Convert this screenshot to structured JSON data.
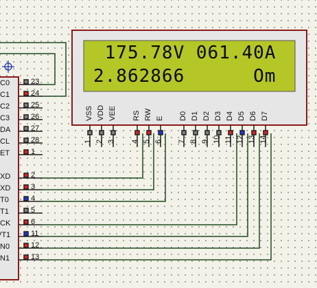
{
  "colors": {
    "wire": "#1f4a1f",
    "component_border": "#8b1a1a",
    "lcd_body": "#e8e8e8",
    "lcd_screen": "#b5c627",
    "pin_red": "#dd2222",
    "pin_blue": "#2233dd",
    "pin_gray": "#808080"
  },
  "lcd": {
    "line1": " 175.78V 061.40A",
    "line2": "2.862866      Om",
    "pins": [
      {
        "name": "VSS",
        "num": "1",
        "state": "gray"
      },
      {
        "name": "VDD",
        "num": "2",
        "state": "gray"
      },
      {
        "name": "VEE",
        "num": "3",
        "state": "gray"
      },
      {
        "name": "RS",
        "num": "4",
        "state": "red"
      },
      {
        "name": "RW",
        "num": "5",
        "state": "red"
      },
      {
        "name": "E",
        "num": "6",
        "state": "blue"
      },
      {
        "name": "D0",
        "num": "7",
        "state": "gray"
      },
      {
        "name": "D1",
        "num": "8",
        "state": "gray"
      },
      {
        "name": "D2",
        "num": "9",
        "state": "gray"
      },
      {
        "name": "D3",
        "num": "10",
        "state": "gray"
      },
      {
        "name": "D4",
        "num": "11",
        "state": "red"
      },
      {
        "name": "D5",
        "num": "12",
        "state": "blue"
      },
      {
        "name": "D6",
        "num": "13",
        "state": "red"
      },
      {
        "name": "D7",
        "num": "14",
        "state": "red"
      }
    ]
  },
  "mcu": {
    "crosshair_icon": "crosshair-icon",
    "pins": [
      {
        "label": "C0",
        "num": "23",
        "state": "gray"
      },
      {
        "label": "C1",
        "num": "24",
        "state": "red"
      },
      {
        "label": "C2",
        "num": "25",
        "state": "gray"
      },
      {
        "label": "C3",
        "num": "26",
        "state": "gray"
      },
      {
        "label": "DA",
        "num": "27",
        "state": "gray"
      },
      {
        "label": "CL",
        "num": "28",
        "state": "gray"
      },
      {
        "label": "ET",
        "num": "1",
        "state": "red"
      },
      {
        "label": "XD",
        "num": "2",
        "state": "red"
      },
      {
        "label": "XD",
        "num": "3",
        "state": "red"
      },
      {
        "label": "T0",
        "num": "4",
        "state": "blue"
      },
      {
        "label": "T1",
        "num": "5",
        "state": "gray"
      },
      {
        "label": "CK",
        "num": "6",
        "state": "red"
      },
      {
        "label": "VT1",
        "num": "11",
        "state": "blue"
      },
      {
        "label": "N0",
        "num": "12",
        "state": "red"
      },
      {
        "label": "N1",
        "num": "13",
        "state": "red"
      }
    ]
  }
}
